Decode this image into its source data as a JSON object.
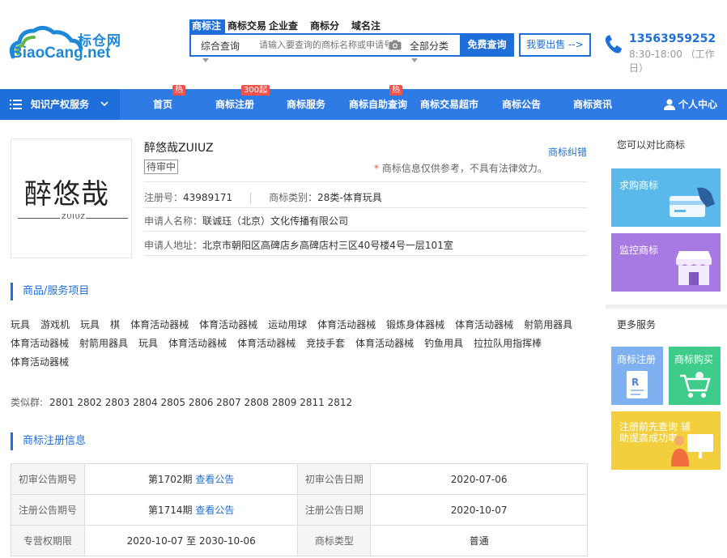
{
  "header": {
    "logo_cn": "标仓网",
    "logo_en": "BiaoCang.net",
    "search_tabs": [
      "商标注",
      "商标交易",
      "企业查",
      "商标分",
      "域名注"
    ],
    "search_scope": "综合查询",
    "search_placeholder": "请输入要查询的商标名称或申请号",
    "search_class": "全部分类",
    "search_button": "免费查询",
    "sell_button": "我要出售 -->",
    "phone": "13563959252",
    "hours": "8:30-18:00 （工作日）"
  },
  "nav": {
    "category": "知识产权服务",
    "items": [
      {
        "label": "首页",
        "badge": "热"
      },
      {
        "label": "商标注册",
        "badge": "300起"
      },
      {
        "label": "商标服务",
        "badge": ""
      },
      {
        "label": "商标自助查询",
        "badge": "热"
      },
      {
        "label": "商标交易超市",
        "badge": ""
      },
      {
        "label": "商标公告",
        "badge": ""
      },
      {
        "label": "商标资讯",
        "badge": ""
      }
    ],
    "user_center": "个人中心"
  },
  "trademark": {
    "image_text": "醉悠哉",
    "image_sub": "ZUIUZ",
    "name": "醉悠哉ZUIUZ",
    "status": "待审中",
    "dispute_link": "商标纠错",
    "notice_star": "*",
    "notice": " 商标信息仅供参考，不具有法律效力。",
    "reg_no_label": "注册号：",
    "reg_no": "43989171",
    "class_label": "商标类别：",
    "class_value": "28类-体育玩具",
    "applicant_label": "申请人名称：",
    "applicant": "联诚珏（北京）文化传播有限公司",
    "address_label": "申请人地址：",
    "address": "北京市朝阳区高碑店乡高碑店村三区40号楼4号一层101室"
  },
  "goods_section": {
    "title": "商品/服务项目",
    "items": [
      "玩具",
      "游戏机",
      "玩具",
      "棋",
      "体育活动器械",
      "体育活动器械",
      "运动用球",
      "体育活动器械",
      "锻炼身体器械",
      "体育活动器械",
      "射箭用器具",
      "体育活动器械",
      "射箭用器具",
      "玩具",
      "体育活动器械",
      "体育活动器械",
      "竞技手套",
      "体育活动器械",
      "钓鱼用具",
      "拉拉队用指挥棒",
      "体育活动器械"
    ],
    "similar_label": "类似群:",
    "similar_groups": "2801 2802 2803 2804 2805 2806 2807 2808 2809 2811 2812"
  },
  "reg_section": {
    "title": "商标注册信息",
    "rows": [
      {
        "k1": "初审公告期号",
        "v1": "第1702期",
        "link": "查看公告",
        "k2": "初审公告日期",
        "v2": "2020-07-06"
      },
      {
        "k1": "注册公告期号",
        "v1": "第1714期",
        "link": "查看公告",
        "k2": "注册公告日期",
        "v2": "2020-10-07"
      },
      {
        "k1": "专营权期限",
        "v1": "2020-10-07 至 2030-10-06",
        "link": "",
        "k2": "商标类型",
        "v2": "普通"
      }
    ]
  },
  "sidebar": {
    "compare_title": "您可以对比商标",
    "buy_label": "求购商标",
    "monitor_label": "监控商标",
    "more_title": "更多服务",
    "register_label": "商标注册",
    "purchase_label": "商标购买",
    "precheck_label": "注册前先查询 辅助提高成功率"
  },
  "colors": {
    "primary": "#1e6fd9",
    "nav": "#2f7be6",
    "badge": "#f0524a",
    "card_buy": "#5bb8ea",
    "card_monitor": "#a779e2",
    "card_register": "#7fb0ef",
    "card_purchase": "#3fcb8a",
    "card_precheck": "#f3cf3e"
  }
}
